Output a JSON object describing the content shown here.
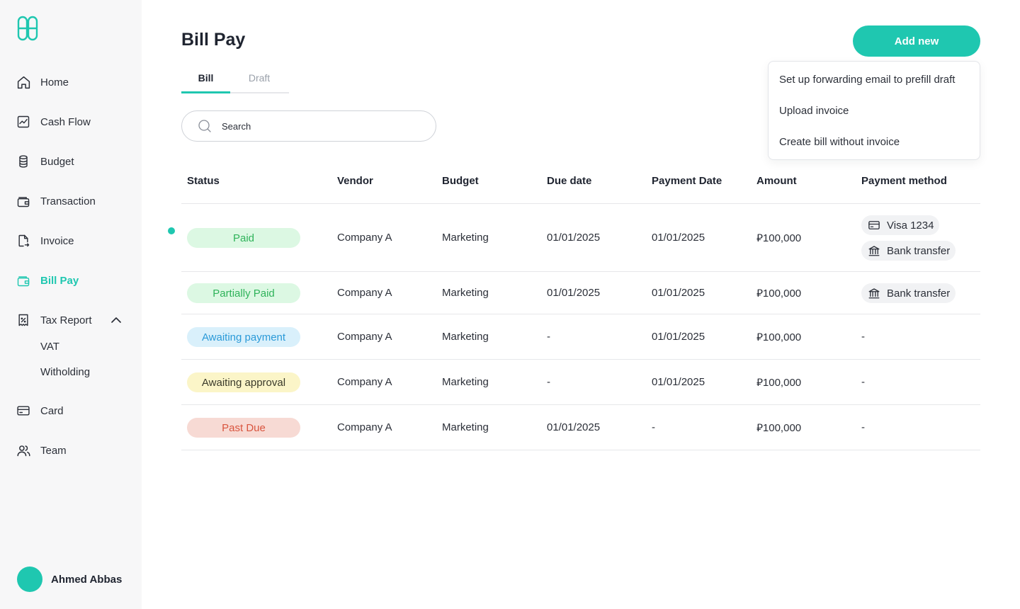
{
  "colors": {
    "accent": "#1fc7b0",
    "paid_bg": "#dcf8e3",
    "paid_text": "#2fb35a",
    "partial_bg": "#dcf8e3",
    "partial_text": "#2fb35a",
    "awaiting_payment_bg": "#d9f0fb",
    "awaiting_payment_text": "#2b9ad8",
    "awaiting_approval_bg": "#fbf5c8",
    "awaiting_approval_text": "#3a3a2a",
    "past_due_bg": "#f7dad4",
    "past_due_text": "#d9553f"
  },
  "sidebar": {
    "items": [
      {
        "label": "Home",
        "icon": "home-icon"
      },
      {
        "label": "Cash Flow",
        "icon": "chart-icon"
      },
      {
        "label": "Budget",
        "icon": "database-icon"
      },
      {
        "label": "Transaction",
        "icon": "wallet-icon"
      },
      {
        "label": "Invoice",
        "icon": "document-icon"
      },
      {
        "label": "Bill Pay",
        "icon": "bill-wallet-icon",
        "active": true
      },
      {
        "label": "Tax Report",
        "icon": "receipt-icon",
        "expanded": true
      },
      {
        "label": "Card",
        "icon": "card-icon"
      },
      {
        "label": "Team",
        "icon": "team-icon"
      }
    ],
    "tax_sub": [
      "VAT",
      "Witholding"
    ],
    "user_name": "Ahmed Abbas"
  },
  "header": {
    "title": "Bill Pay",
    "add_button": "Add new"
  },
  "tabs": [
    "Bill",
    "Draft"
  ],
  "search": {
    "placeholder": "Search"
  },
  "dropdown": {
    "items": [
      "Set up forwarding email to prefill draft",
      "Upload invoice",
      "Create bill without invoice"
    ]
  },
  "table": {
    "columns": [
      "Status",
      "Vendor",
      "Budget",
      "Due date",
      "Payment Date",
      "Amount",
      "Payment method"
    ],
    "rows": [
      {
        "status": "Paid",
        "vendor": "Company A",
        "budget": "Marketing",
        "due": "01/01/2025",
        "paid_on": "01/01/2025",
        "amount": "⃁100,000",
        "methods": [
          "Visa 1234",
          "Bank transfer"
        ]
      },
      {
        "status": "Partially Paid",
        "vendor": "Company A",
        "budget": "Marketing",
        "due": "01/01/2025",
        "paid_on": "01/01/2025",
        "amount": "⃁100,000",
        "methods": [
          "Bank transfer"
        ]
      },
      {
        "status": "Awaiting payment",
        "vendor": "Company A",
        "budget": "Marketing",
        "due": "-",
        "paid_on": "01/01/2025",
        "amount": "⃁100,000",
        "method_text": "-"
      },
      {
        "status": "Awaiting approval",
        "vendor": "Company A",
        "budget": "Marketing",
        "due": "-",
        "paid_on": "01/01/2025",
        "amount": "⃁100,000",
        "method_text": "-"
      },
      {
        "status": "Past Due",
        "vendor": "Company A",
        "budget": "Marketing",
        "due": "01/01/2025",
        "paid_on": "-",
        "amount": "⃁100,000",
        "method_text": "-"
      }
    ]
  }
}
